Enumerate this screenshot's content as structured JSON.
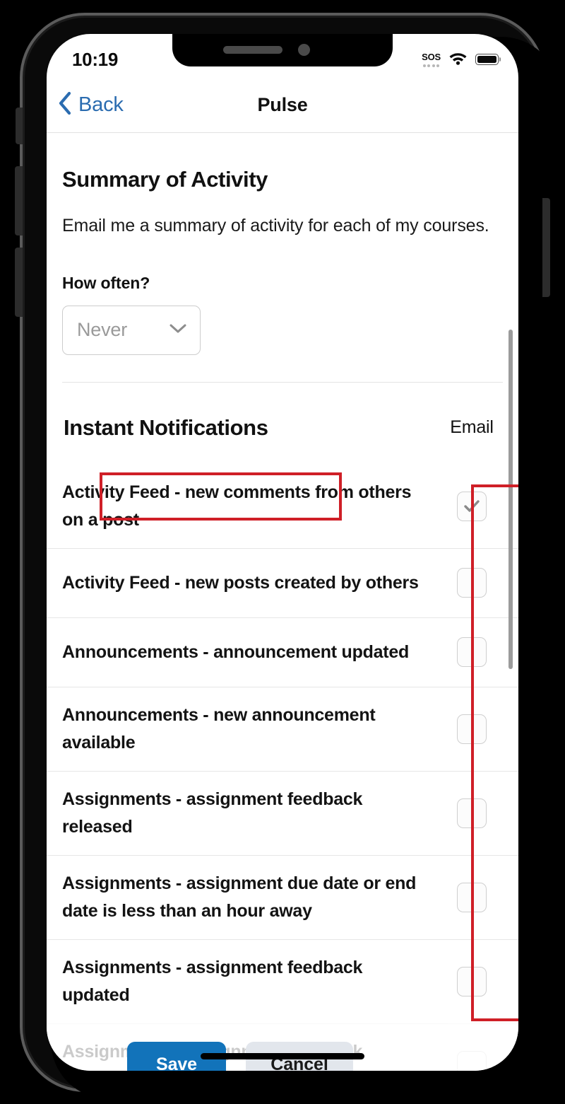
{
  "statusbar": {
    "time": "10:19",
    "sos_label": "SOS",
    "wifi_icon": "wifi-icon",
    "battery_icon": "battery-full-icon"
  },
  "navbar": {
    "back_label": "Back",
    "back_icon": "chevron-left-icon",
    "title": "Pulse"
  },
  "summary": {
    "heading": "Summary of Activity",
    "description": "Email me a summary of activity for each of my courses.",
    "frequency_label": "How often?",
    "frequency_value": "Never",
    "frequency_chevron_icon": "chevron-down-icon"
  },
  "instant": {
    "heading": "Instant Notifications",
    "email_column_header": "Email",
    "rows": [
      {
        "label": "Activity Feed - new comments from others on a post",
        "email_checked": true,
        "faded": false
      },
      {
        "label": "Activity Feed - new posts created by others",
        "email_checked": false,
        "faded": false
      },
      {
        "label": "Announcements - announcement updated",
        "email_checked": false,
        "faded": false
      },
      {
        "label": "Announcements - new announcement available",
        "email_checked": false,
        "faded": false
      },
      {
        "label": "Assignments - assignment feedback released",
        "email_checked": false,
        "faded": false
      },
      {
        "label": "Assignments - assignment due date or end date is less than an hour away",
        "email_checked": false,
        "faded": false
      },
      {
        "label": "Assignments - assignment feedback updated",
        "email_checked": false,
        "faded": false
      },
      {
        "label": "Assignments - assignment feedback completion",
        "email_checked": false,
        "faded": true
      }
    ]
  },
  "actions": {
    "save_label": "Save",
    "cancel_label": "Cancel"
  },
  "annotations": {
    "color": "#cf1f27",
    "boxes": [
      {
        "name": "instant-notifications-title-highlight"
      },
      {
        "name": "email-column-highlight"
      }
    ]
  }
}
